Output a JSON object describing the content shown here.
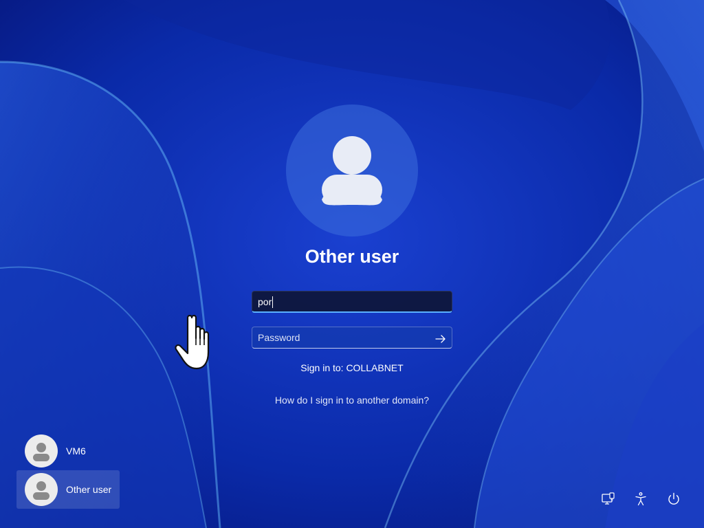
{
  "colors": {
    "accent_underline": "#5ab0ff",
    "wallpaper_base": "#0a2aa8",
    "avatar_fill": "#ececec"
  },
  "login": {
    "title": "Other user",
    "username_value": "por",
    "password_placeholder": "Password",
    "signin_to": "Sign in to: COLLABNET",
    "help_link": "How do I sign in to another domain?",
    "avatar_icon": "user-icon",
    "submit_icon": "arrow-right-icon"
  },
  "users": [
    {
      "name": "VM6",
      "selected": false,
      "icon": "user-icon"
    },
    {
      "name": "Other user",
      "selected": true,
      "icon": "user-icon"
    }
  ],
  "system_icons": [
    {
      "name": "network-icon"
    },
    {
      "name": "accessibility-icon"
    },
    {
      "name": "power-icon"
    }
  ],
  "pointer": {
    "icon": "hand-pointer-icon"
  }
}
